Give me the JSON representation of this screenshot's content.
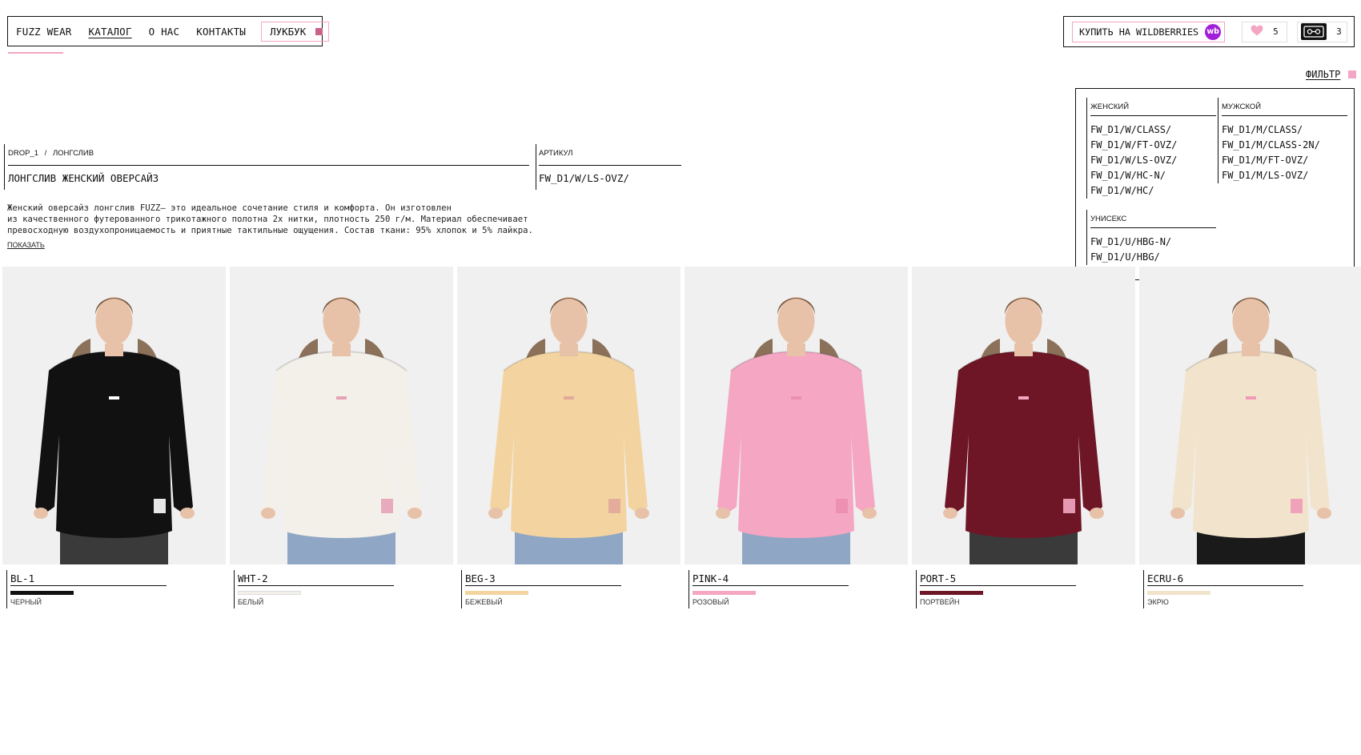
{
  "header": {
    "brand": "FUZZ WEAR",
    "nav": [
      {
        "label": "КАТАЛОГ",
        "active": true
      },
      {
        "label": "О НАС",
        "active": false
      },
      {
        "label": "КОНТАКТЫ",
        "active": false
      }
    ],
    "lookbook_label": "ЛУКБУК",
    "accent_color": "#f3a6c4",
    "lookbook_square_color": "#c8648c",
    "wb_button_label": "КУПИТЬ НА WILDBERRIES",
    "wb_logo_text": "wb",
    "wb_logo_color": "#a21fd9",
    "favorites_count": "5",
    "cart_count": "3"
  },
  "filter": {
    "toggle_label": "ФИЛЬТР",
    "groups": [
      {
        "title": "ЖЕНСКИЙ",
        "items": [
          "FW_D1/W/CLASS/",
          "FW_D1/W/FT-OVZ/",
          "FW_D1/W/LS-OVZ/",
          "FW_D1/W/HC-N/",
          "FW_D1/W/HC/"
        ]
      },
      {
        "title": "МУЖСКОЙ",
        "items": [
          "FW_D1/M/CLASS/",
          "FW_D1/M/CLASS-2N/",
          "FW_D1/M/FT-OVZ/",
          "FW_D1/M/LS-OVZ/"
        ]
      },
      {
        "title": "УНИСЕКС",
        "items": [
          "FW_D1/U/HBG-N/",
          "FW_D1/U/HBG/"
        ]
      }
    ]
  },
  "product": {
    "breadcrumb": {
      "drop": "DROP_1",
      "separator": "/",
      "category": "ЛОНГСЛИВ"
    },
    "title": "ЛОНГСЛИВ ЖЕНСКИЙ ОВЕРСАЙЗ",
    "sku_label": "АРТИКУЛ",
    "sku": "FW_D1/W/LS-OVZ/",
    "description": [
      "Женский оверсайз лонгслив FUZZ— это идеальное сочетание стиля и комфорта. Он изготовлен",
      "из качественного футерованного трикотажного полотна 2х нитки, плотность 250 г/м. Материал обеспечивает",
      "превосходную воздухопроницаемость и приятные тактильные ощущения. Состав ткани: 95% хлопок и 5% лайкра."
    ],
    "show_more": "ПОКАЗАТЬ"
  },
  "variants": [
    {
      "code": "BL-1",
      "color_name": "ЧЕРНЫЙ",
      "color": "#111111",
      "chest_logo": "#ffffff"
    },
    {
      "code": "WHT-2",
      "color_name": "БЕЛЫЙ",
      "color": "#f3efe9",
      "chest_logo": "#e7a2b8"
    },
    {
      "code": "BEG-3",
      "color_name": "БЕЖЕВЫЙ",
      "color": "#f3d4a0",
      "chest_logo": "#e2a89a"
    },
    {
      "code": "PINK-4",
      "color_name": "РОЗОВЫЙ",
      "color": "#f4a6c2",
      "chest_logo": "#ec8fb0"
    },
    {
      "code": "PORT-5",
      "color_name": "ПОРТВЕЙН",
      "color": "#6e1526",
      "chest_logo": "#f2a7c0"
    },
    {
      "code": "ECRU-6",
      "color_name": "ЭКРЮ",
      "color": "#f2e4cc",
      "chest_logo": "#f09ab8"
    }
  ]
}
